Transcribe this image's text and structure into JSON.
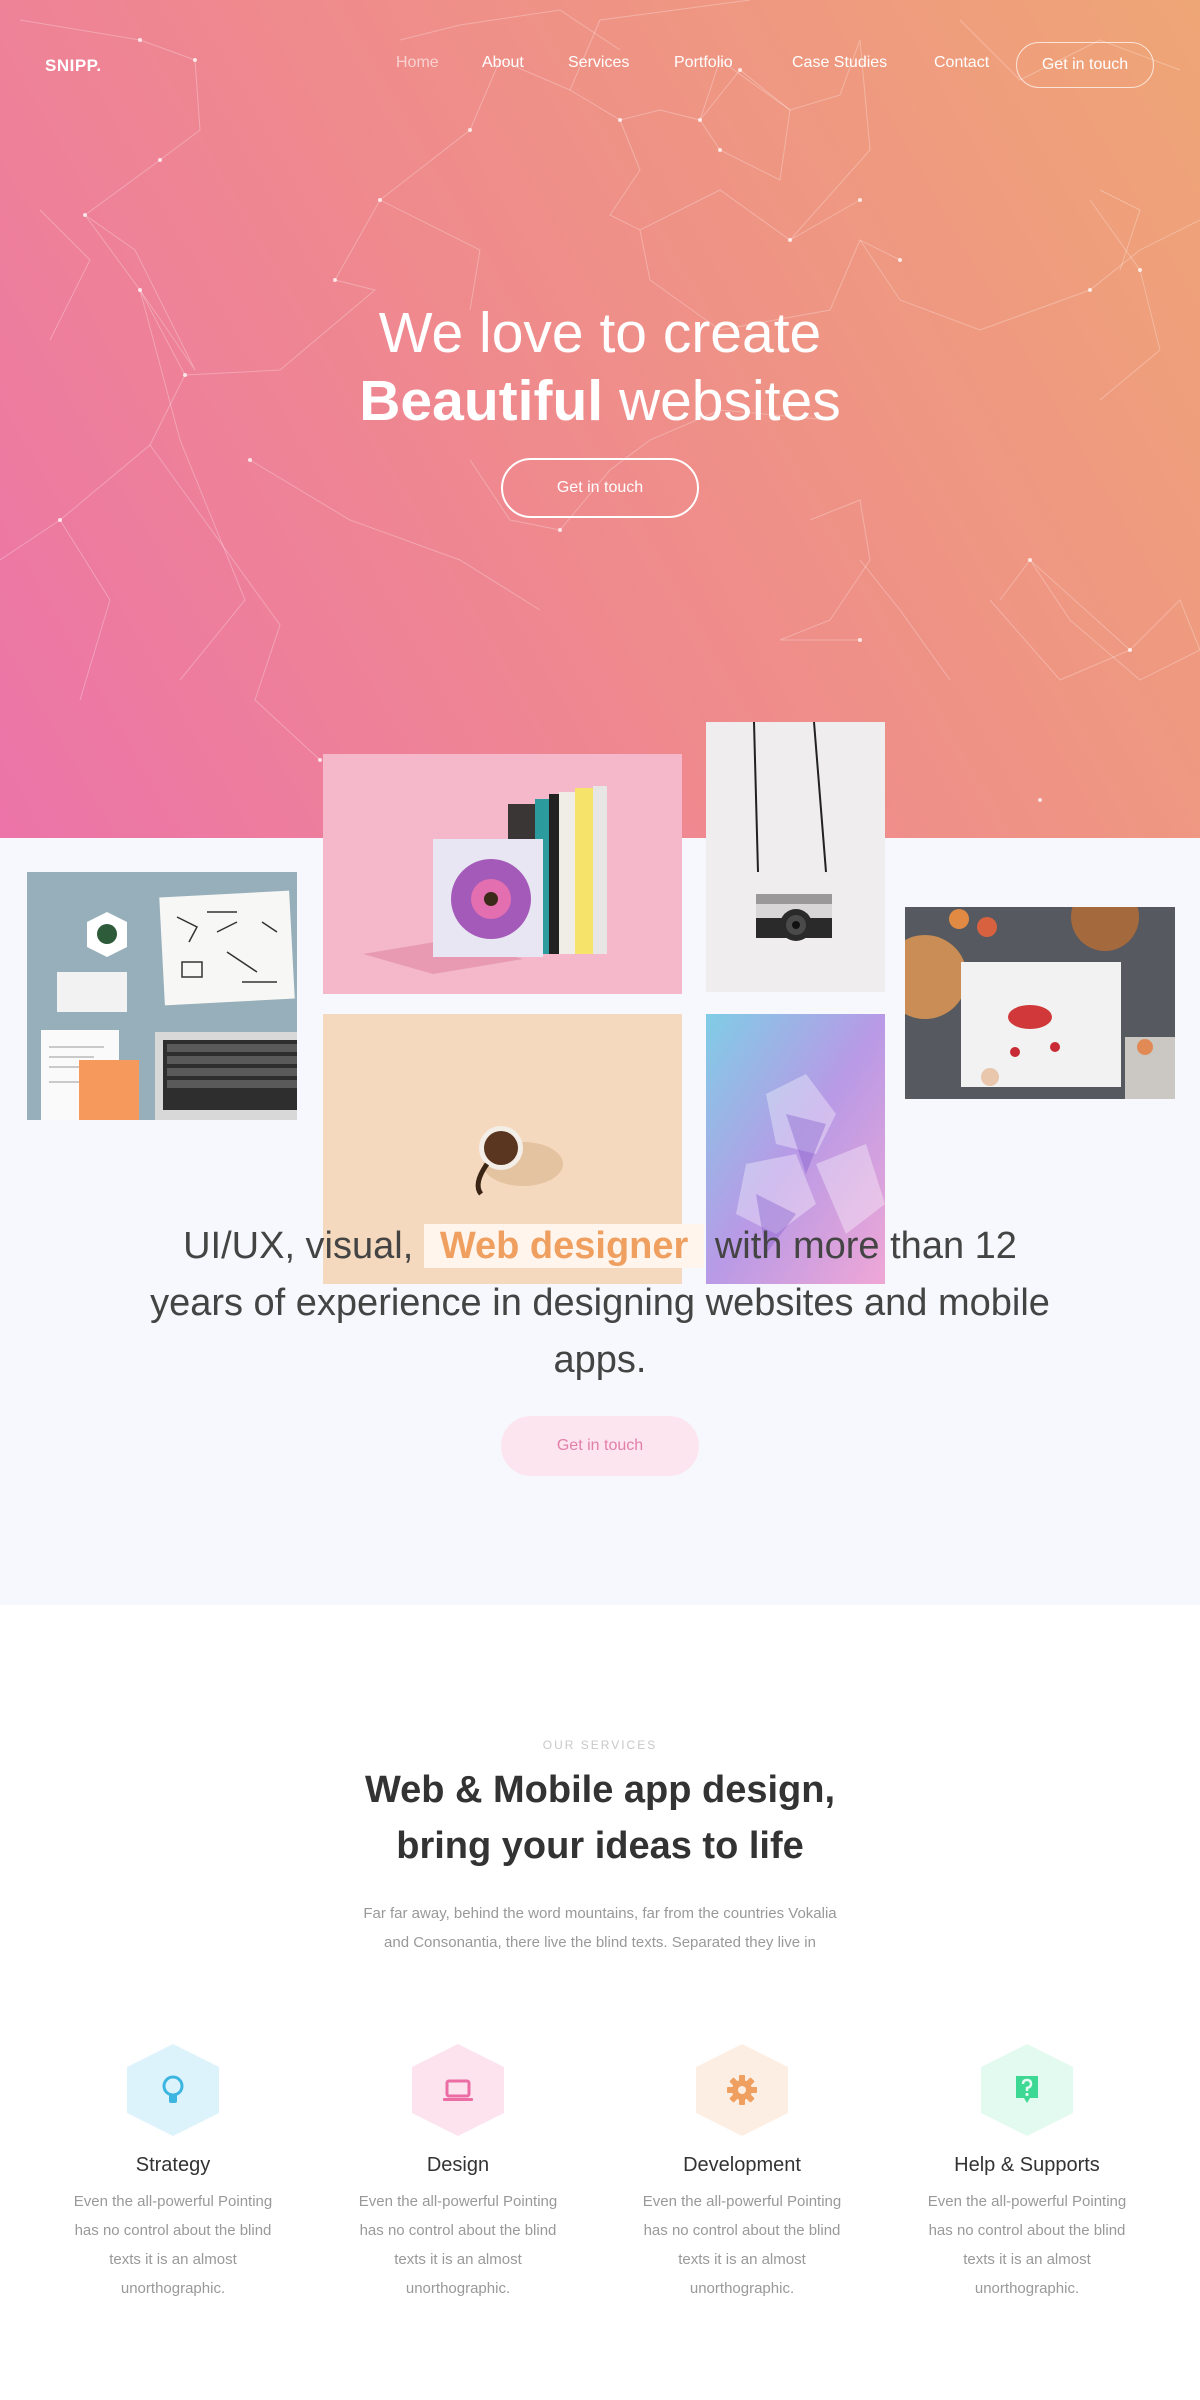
{
  "brand": {
    "logo": "SNIPP."
  },
  "nav": {
    "items": [
      {
        "label": "Home",
        "active": true
      },
      {
        "label": "About",
        "active": false
      },
      {
        "label": "Services",
        "active": false
      },
      {
        "label": "Portfolio",
        "active": false
      },
      {
        "label": "Case Studies",
        "active": false
      },
      {
        "label": "Contact",
        "active": false
      }
    ],
    "cta": "Get in touch"
  },
  "hero": {
    "line1": "We love to create",
    "line2_bold": "Beautiful",
    "line2_rest": " websites",
    "cta": "Get in touch",
    "gradient": [
      "#ec74a9",
      "#efa676"
    ]
  },
  "gallery": {
    "images": [
      "desk-workspace",
      "books",
      "camera",
      "food-table",
      "coffee-cup",
      "crystal"
    ]
  },
  "about": {
    "text_before": "UI/UX, visual, ",
    "highlight": "Web designer",
    "text_after": " with more than 12 years of experience in designing websites and mobile apps.",
    "cta": "Get in touch",
    "highlight_color": "#efa060"
  },
  "services": {
    "eyebrow": "OUR SERVICES",
    "title_line1": "Web & Mobile app design,",
    "title_line2": "bring your ideas to life",
    "desc_line1": "Far far away, behind the word mountains, far from the countries Vokalia",
    "desc_line2": "and Consonantia, there live the blind texts. Separated they live in",
    "items": [
      {
        "title": "Strategy",
        "icon": "lightbulb-icon",
        "color": "#3cb6e0",
        "bg": "#ddf3fb",
        "text": "Even the all-powerful Pointing has no control about the blind texts it is an almost unorthographic."
      },
      {
        "title": "Design",
        "icon": "laptop-icon",
        "color": "#ec6ca4",
        "bg": "#fde3ee",
        "text": "Even the all-powerful Pointing has no control about the blind texts it is an almost unorthographic."
      },
      {
        "title": "Development",
        "icon": "gear-icon",
        "color": "#efa060",
        "bg": "#fdeee3",
        "text": "Even the all-powerful Pointing has no control about the blind texts it is an almost unorthographic."
      },
      {
        "title": "Help & Supports",
        "icon": "help-chat-icon",
        "color": "#3dd893",
        "bg": "#e2faef",
        "text": "Even the all-powerful Pointing has no control about the blind texts it is an almost unorthographic."
      }
    ]
  }
}
